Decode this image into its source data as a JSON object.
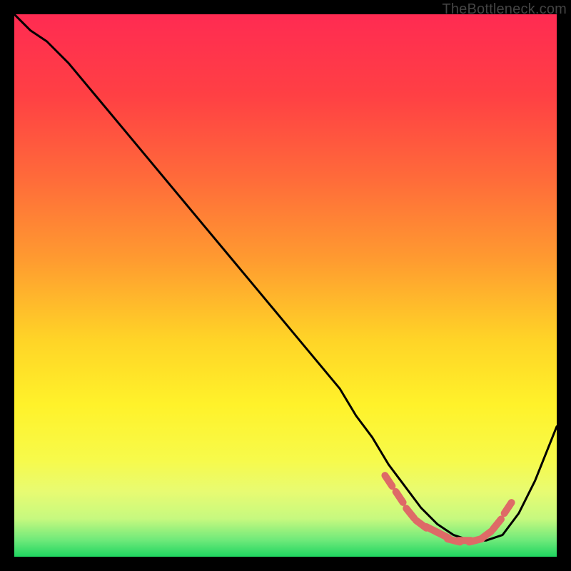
{
  "watermark": "TheBottleneck.com",
  "chart_data": {
    "type": "line",
    "title": "",
    "xlabel": "",
    "ylabel": "",
    "xlim": [
      0,
      100
    ],
    "ylim": [
      0,
      100
    ],
    "grid": false,
    "series": [
      {
        "name": "bottleneck-curve",
        "x": [
          0,
          3,
          6,
          10,
          15,
          20,
          25,
          30,
          35,
          40,
          45,
          50,
          55,
          60,
          63,
          66,
          69,
          72,
          75,
          78,
          81,
          84,
          87,
          90,
          93,
          96,
          100
        ],
        "y": [
          100,
          97,
          95,
          91,
          85,
          79,
          73,
          67,
          61,
          55,
          49,
          43,
          37,
          31,
          26,
          22,
          17,
          13,
          9,
          6,
          4,
          3,
          3,
          4,
          8,
          14,
          24
        ]
      }
    ],
    "highlighted_region": {
      "name": "optimal-zone-markers",
      "x": [
        69,
        71,
        73,
        75,
        77,
        79,
        81,
        83,
        85,
        87,
        89,
        91
      ],
      "y": [
        14,
        11,
        8,
        6,
        5,
        4,
        3,
        3,
        3,
        4,
        6,
        9
      ],
      "color": "#de6a67"
    },
    "gradient_stops": [
      {
        "offset": 0,
        "color": "#ff2b52"
      },
      {
        "offset": 15,
        "color": "#ff4044"
      },
      {
        "offset": 30,
        "color": "#ff6a3a"
      },
      {
        "offset": 45,
        "color": "#ff9a30"
      },
      {
        "offset": 60,
        "color": "#ffd427"
      },
      {
        "offset": 72,
        "color": "#fff22a"
      },
      {
        "offset": 82,
        "color": "#f7fa4a"
      },
      {
        "offset": 88,
        "color": "#e8fb72"
      },
      {
        "offset": 93,
        "color": "#c6f97f"
      },
      {
        "offset": 97,
        "color": "#6de97a"
      },
      {
        "offset": 100,
        "color": "#1fd560"
      }
    ]
  }
}
